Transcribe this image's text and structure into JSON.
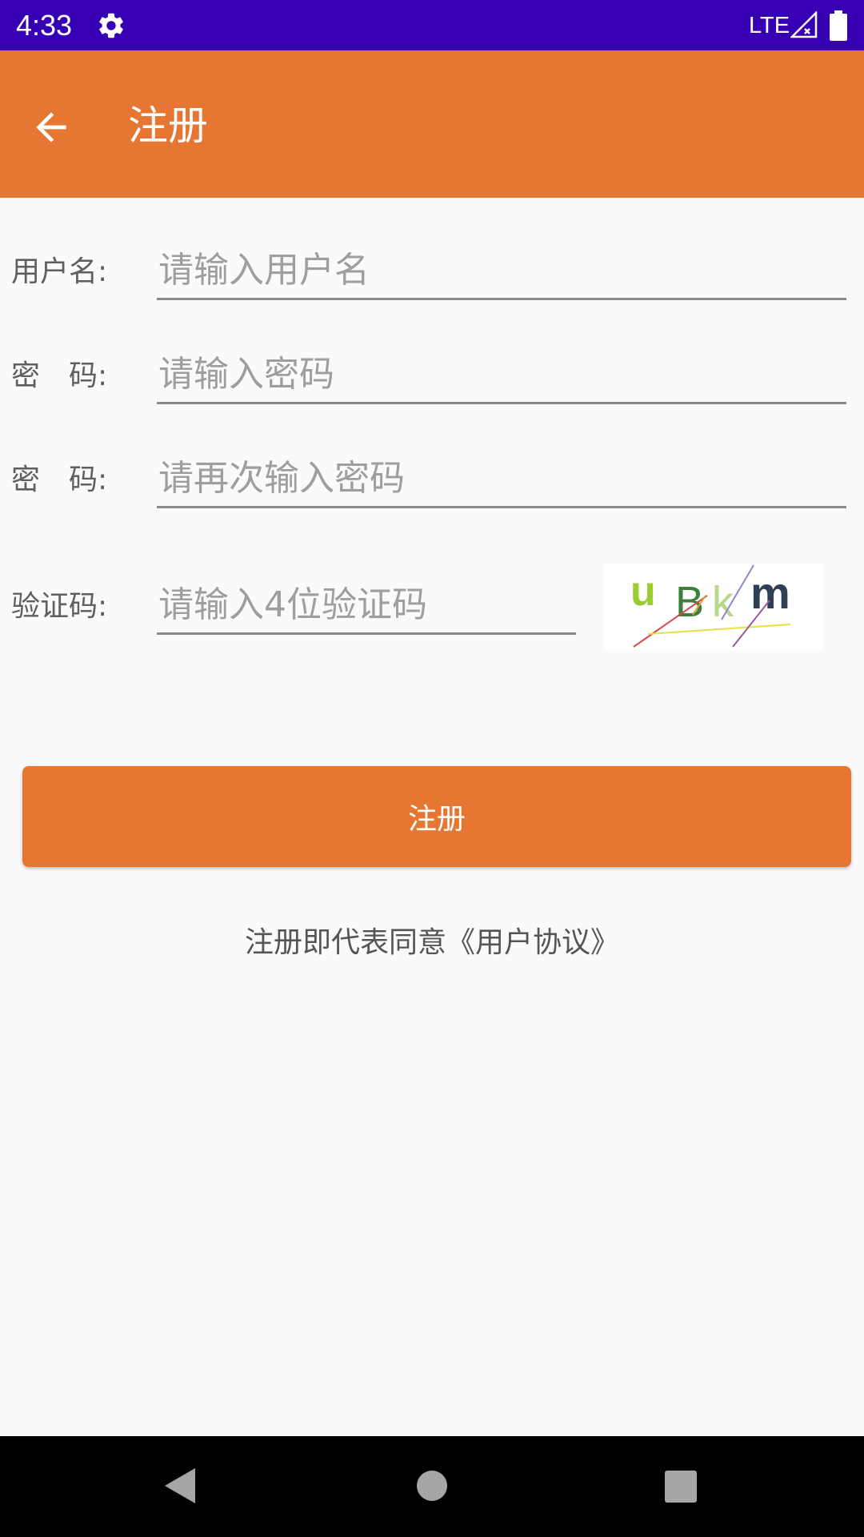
{
  "status_bar": {
    "time": "4:33",
    "network": "LTE",
    "icons": [
      "gear-icon",
      "signal-icon",
      "battery-icon"
    ],
    "background_color": "#3700B3"
  },
  "app_bar": {
    "title": "注册",
    "back_icon": "arrow-left-icon",
    "background_color": "#E57733"
  },
  "form": {
    "username": {
      "label": "用户名:",
      "placeholder": "请输入用户名",
      "value": ""
    },
    "password": {
      "label": "密　码:",
      "placeholder": "请输入密码",
      "value": ""
    },
    "password_confirm": {
      "label": "密　码:",
      "placeholder": "请再次输入密码",
      "value": ""
    },
    "captcha": {
      "label": "验证码:",
      "placeholder": "请输入4位验证码",
      "value": "",
      "image_text": "uBkm"
    }
  },
  "register_button": {
    "label": "注册",
    "color": "#E57733"
  },
  "agreement": "注册即代表同意《用户协议》",
  "nav_bar": {
    "icons": [
      "back-triangle-icon",
      "home-circle-icon",
      "recents-square-icon"
    ]
  }
}
